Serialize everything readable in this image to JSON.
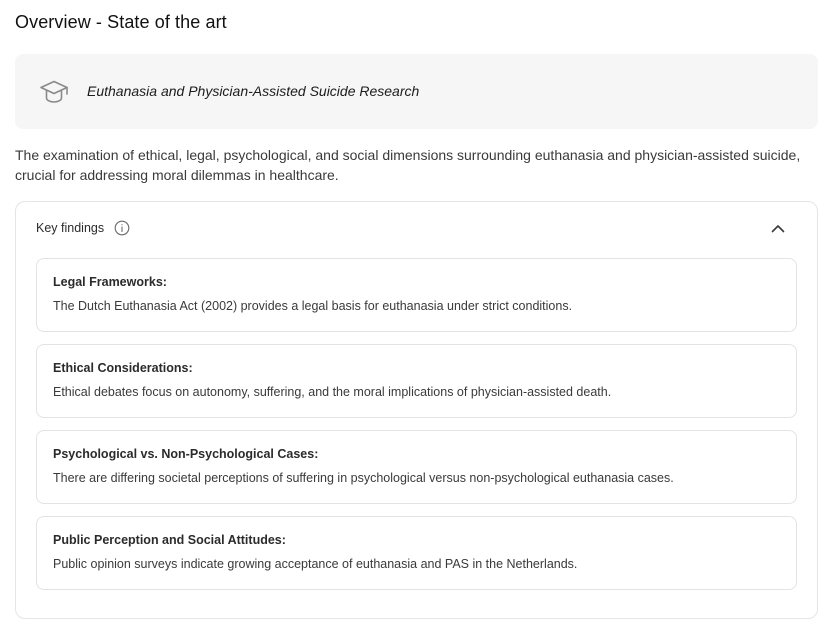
{
  "page": {
    "title": "Overview - State of the art"
  },
  "topic": {
    "icon": "graduation-cap-icon",
    "label": "Euthanasia and Physician-Assisted Suicide Research"
  },
  "description": "The examination of ethical, legal, psychological, and social dimensions surrounding euthanasia and physician-assisted suicide, crucial for addressing moral dilemmas in healthcare.",
  "key_findings": {
    "label": "Key findings",
    "info_icon": "info-icon",
    "collapse_icon": "chevron-up-icon",
    "items": [
      {
        "title": "Legal Frameworks:",
        "text": "The Dutch Euthanasia Act (2002) provides a legal basis for euthanasia under strict conditions."
      },
      {
        "title": "Ethical Considerations:",
        "text": "Ethical debates focus on autonomy, suffering, and the moral implications of physician-assisted death."
      },
      {
        "title": "Psychological vs. Non-Psychological Cases:",
        "text": "There are differing societal perceptions of suffering in psychological versus non-psychological euthanasia cases."
      },
      {
        "title": "Public Perception and Social Attitudes:",
        "text": "Public opinion surveys indicate growing acceptance of euthanasia and PAS in the Netherlands."
      }
    ]
  },
  "colors": {
    "banner_bg": "#f5f6f5",
    "border": "#e5e5e5",
    "text": "#1f1f1f",
    "muted_text": "#3a3a3a"
  }
}
